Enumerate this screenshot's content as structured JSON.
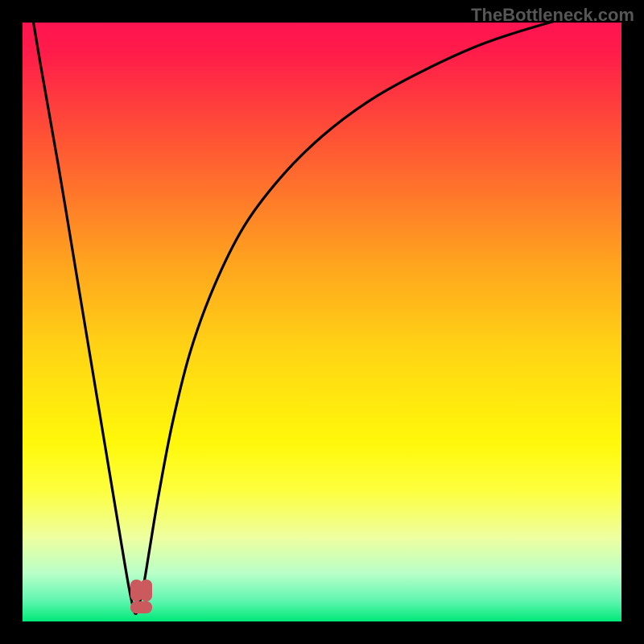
{
  "watermark": "TheBottleneck.com",
  "chart_data": {
    "type": "line",
    "title": "",
    "xlabel": "",
    "ylabel": "",
    "xlim": [
      0,
      100
    ],
    "ylim": [
      0,
      100
    ],
    "gradient_stops": [
      {
        "pos": 0,
        "color": "#ff1450"
      },
      {
        "pos": 0.05,
        "color": "#ff1c4a"
      },
      {
        "pos": 0.2,
        "color": "#ff5534"
      },
      {
        "pos": 0.4,
        "color": "#ffa31e"
      },
      {
        "pos": 0.55,
        "color": "#ffd514"
      },
      {
        "pos": 0.7,
        "color": "#fff80a"
      },
      {
        "pos": 0.78,
        "color": "#fdff3c"
      },
      {
        "pos": 0.86,
        "color": "#eeffa0"
      },
      {
        "pos": 0.92,
        "color": "#b8ffc8"
      },
      {
        "pos": 0.965,
        "color": "#60f6b0"
      },
      {
        "pos": 1.0,
        "color": "#00e878"
      }
    ],
    "series": [
      {
        "name": "bottleneck-curve",
        "x": [
          0.5,
          3,
          6,
          9,
          11,
          13,
          15,
          16.5,
          17.7,
          18.5,
          18.9,
          19.3,
          20.2,
          21.2,
          22.7,
          25,
          28,
          32,
          37,
          43,
          50,
          58,
          67,
          77,
          88,
          100
        ],
        "values": [
          108,
          93,
          76,
          58,
          46,
          34,
          22,
          13,
          6,
          2.2,
          1.3,
          2.2,
          6,
          12,
          21,
          33,
          45,
          56,
          66,
          74,
          81,
          87,
          92,
          96.5,
          100,
          103
        ]
      }
    ],
    "markers": [
      {
        "name": "min-left",
        "x": 18.0,
        "y": 3.4,
        "w": 2.0,
        "h": 3.6
      },
      {
        "name": "min-right",
        "x": 19.6,
        "y": 3.4,
        "w": 2.0,
        "h": 3.6
      },
      {
        "name": "min-base",
        "x": 18.0,
        "y": 1.4,
        "w": 3.6,
        "h": 2.0
      }
    ]
  }
}
